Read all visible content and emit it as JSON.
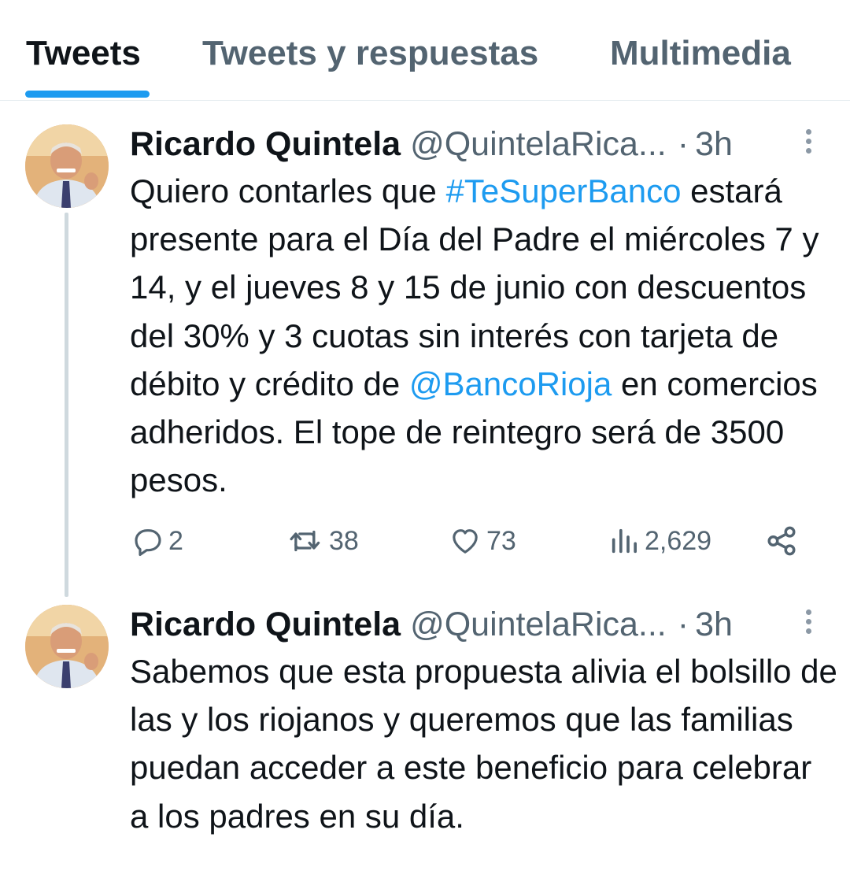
{
  "tabs": [
    {
      "label": "Tweets",
      "active": true
    },
    {
      "label": "Tweets y respuestas",
      "active": false
    },
    {
      "label": "Multimedia",
      "active": false
    }
  ],
  "colors": {
    "accent": "#1d9bf0",
    "text_primary": "#0f1419",
    "text_secondary": "#536471",
    "divider": "#e6ecf0"
  },
  "tweets": [
    {
      "author_name": "Ricardo Quintela",
      "handle": "@QuintelaRica...",
      "separator": "·",
      "time": "3h",
      "text_parts": {
        "p1": "Quiero contarles que ",
        "hashtag": "#TeSuperBanco",
        "p2": " estará presente para el Día del Padre el miércoles 7 y 14, y el jueves 8 y 15 de junio con descuentos del 30% y 3 cuotas sin interés con tarjeta de débito y crédito de ",
        "mention": "@BancoRioja",
        "p3": " en comercios adheridos. El tope de reintegro será de 3500 pesos."
      },
      "stats": {
        "replies": "2",
        "retweets": "38",
        "likes": "73",
        "views": "2,629"
      },
      "icons": [
        "reply-icon",
        "retweet-icon",
        "like-icon",
        "views-icon",
        "share-icon",
        "more-icon"
      ]
    },
    {
      "author_name": "Ricardo Quintela",
      "handle": "@QuintelaRica...",
      "separator": "·",
      "time": "3h",
      "text": "Sabemos que esta propuesta alivia el bolsillo de las y los riojanos y queremos que las familias puedan acceder a este beneficio para celebrar a los padres en su día."
    }
  ]
}
